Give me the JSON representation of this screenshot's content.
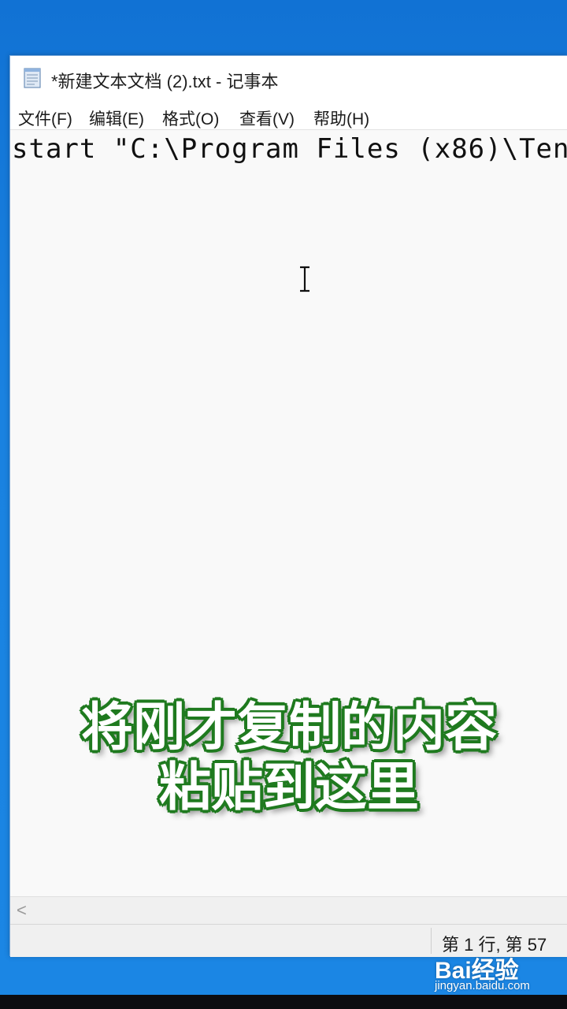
{
  "window": {
    "title": "*新建文本文档 (2).txt - 记事本"
  },
  "menu": {
    "items": [
      {
        "label": "文件(F)"
      },
      {
        "label": "编辑(E)"
      },
      {
        "label": "格式(O)"
      },
      {
        "label": "查看(V)"
      },
      {
        "label": "帮助(H)"
      }
    ]
  },
  "editor": {
    "line1": "start \"C:\\Program Files (x86)\\Ten"
  },
  "caption": {
    "line1": "将刚才复制的内容",
    "line2": "粘贴到这里"
  },
  "scrollbar": {
    "left_arrow": "<"
  },
  "status": {
    "position": "第 1 行, 第 57"
  },
  "watermark": {
    "logo": "Bai经验",
    "url": "jingyan.baidu.com"
  },
  "colors": {
    "desktop": "#1a82e0",
    "caption_outline": "#1f7a1f"
  },
  "icons": {
    "app": "notepad-icon",
    "cursor": "text-cursor-icon"
  }
}
